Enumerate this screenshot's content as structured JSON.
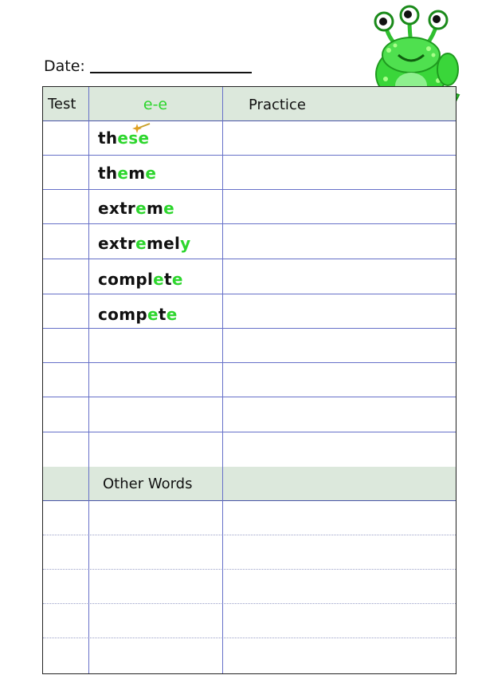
{
  "date_label": "Date:",
  "headers": {
    "test": "Test",
    "pattern": "e-e",
    "practice": "Practice"
  },
  "words": [
    [
      {
        "t": "th",
        "c": "b"
      },
      {
        "t": "ese",
        "c": "g"
      }
    ],
    [
      {
        "t": "th",
        "c": "b"
      },
      {
        "t": "e",
        "c": "g"
      },
      {
        "t": "m",
        "c": "b"
      },
      {
        "t": "e",
        "c": "g"
      }
    ],
    [
      {
        "t": "extr",
        "c": "b"
      },
      {
        "t": "e",
        "c": "g"
      },
      {
        "t": "m",
        "c": "b"
      },
      {
        "t": "e",
        "c": "g"
      }
    ],
    [
      {
        "t": "extr",
        "c": "b"
      },
      {
        "t": "e",
        "c": "g"
      },
      {
        "t": "mel",
        "c": "b"
      },
      {
        "t": "y",
        "c": "g"
      }
    ],
    [
      {
        "t": "compl",
        "c": "b"
      },
      {
        "t": "e",
        "c": "g"
      },
      {
        "t": "t",
        "c": "b"
      },
      {
        "t": "e",
        "c": "g"
      }
    ],
    [
      {
        "t": "comp",
        "c": "b"
      },
      {
        "t": "e",
        "c": "g"
      },
      {
        "t": "t",
        "c": "b"
      },
      {
        "t": "e",
        "c": "g"
      }
    ]
  ],
  "other_words_label": "Other Words",
  "colors": {
    "highlight": "#2dd62d",
    "header_bg": "#dce8dc",
    "rule": "#6670c8"
  }
}
